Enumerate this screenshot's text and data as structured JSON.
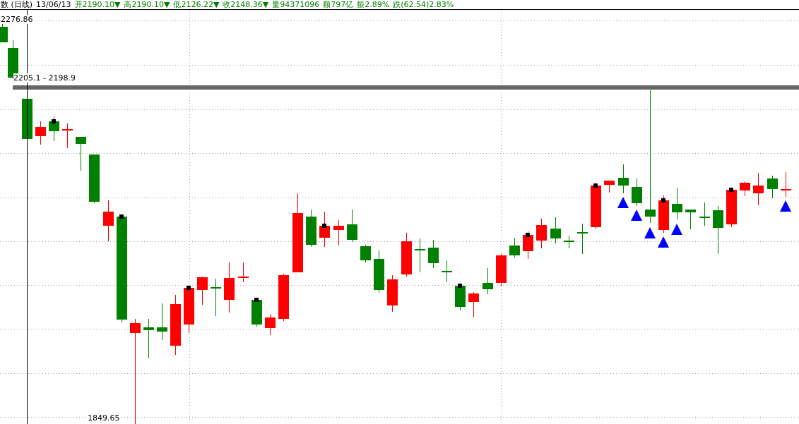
{
  "header": {
    "title": "数 (日线)",
    "date": "13/06/13",
    "fields": [
      {
        "text": "开2190.10▼"
      },
      {
        "text": "高2190.10▼"
      },
      {
        "text": "低2126.22▼"
      },
      {
        "text": "收2148.36▼"
      },
      {
        "text": "量94371096"
      },
      {
        "text": "额797亿"
      },
      {
        "text": "振2.89%"
      },
      {
        "text": "跌(62.54)2.83%"
      }
    ]
  },
  "chart": {
    "high_label": "2276.86",
    "band_label": "2205.1 - 2198.9",
    "low_label": "1849.65"
  }
}
